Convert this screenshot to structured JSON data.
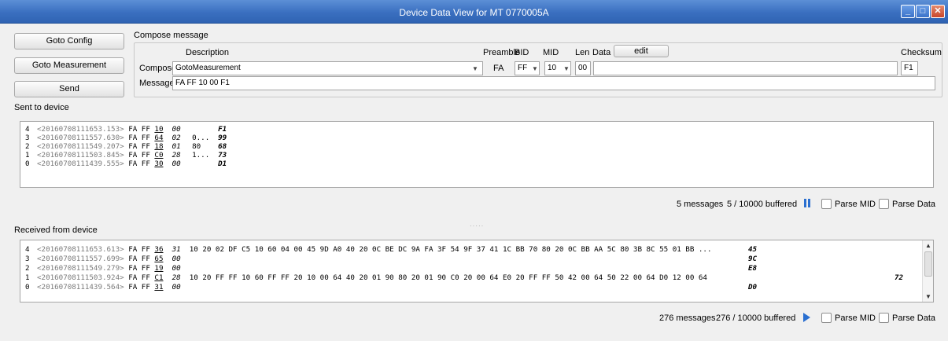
{
  "window": {
    "title": "Device Data View for MT 0770005A"
  },
  "buttons": {
    "goto_config": "Goto Config",
    "goto_measurement": "Goto Measurement",
    "send": "Send",
    "edit": "edit"
  },
  "compose": {
    "group_title": "Compose message",
    "col_description": "Description",
    "col_preamble": "Preamble",
    "col_bid": "BID",
    "col_mid": "MID",
    "col_len": "Len",
    "col_data": "Data",
    "col_checksum": "Checksum",
    "compose_label": "Compose:",
    "description_value": "GotoMeasurement",
    "preamble_value": "FA",
    "bid_value": "FF",
    "mid_value": "10",
    "len_value": "00",
    "data_value": "",
    "checksum_value": "F1",
    "message_label": "Message:",
    "message_value": "FA FF 10 00 F1"
  },
  "sent": {
    "title": "Sent to device",
    "lines": [
      {
        "idx": "4",
        "ts": "<20160708111653.153>",
        "hdr": "FA FF",
        "mid": "10",
        "len": "00",
        "data": "",
        "cs": "F1"
      },
      {
        "idx": "3",
        "ts": "<20160708111557.630>",
        "hdr": "FA FF",
        "mid": "64",
        "len": "02",
        "data": "0...",
        "cs": "99"
      },
      {
        "idx": "2",
        "ts": "<20160708111549.207>",
        "hdr": "FA FF",
        "mid": "18",
        "len": "01",
        "data": "80",
        "cs": "68"
      },
      {
        "idx": "1",
        "ts": "<20160708111503.845>",
        "hdr": "FA FF",
        "mid": "C0",
        "len": "28",
        "data": "1...",
        "cs": "73"
      },
      {
        "idx": "0",
        "ts": "<20160708111439.555>",
        "hdr": "FA FF",
        "mid": "30",
        "len": "00",
        "data": "",
        "cs": "D1"
      }
    ],
    "messages": "5 messages",
    "buffered": "5 / 10000 buffered",
    "pause_icon": "pause-icon",
    "parse_mid": "Parse MID",
    "parse_data": "Parse Data"
  },
  "received": {
    "title": "Received from device",
    "lines": [
      {
        "idx": "4",
        "ts": "<20160708111653.613>",
        "hdr": "FA FF",
        "mid": "36",
        "len": "31",
        "data": "10 20 02 DF C5 10 60 04 00 45 9D A0 40 20 0C BE DC 9A FA 3F 54 9F 37 41 1C BB 70 80 20 0C BB AA 5C 80 3B 8C 55 01 BB ...",
        "cs": "45"
      },
      {
        "idx": "3",
        "ts": "<20160708111557.699>",
        "hdr": "FA FF",
        "mid": "65",
        "len": "00",
        "data": "",
        "cs": "9C"
      },
      {
        "idx": "2",
        "ts": "<20160708111549.279>",
        "hdr": "FA FF",
        "mid": "19",
        "len": "00",
        "data": "",
        "cs": "E8"
      },
      {
        "idx": "1",
        "ts": "<20160708111503.924>",
        "hdr": "FA FF",
        "mid": "C1",
        "len": "28",
        "data": "10 20 FF FF 10 60 FF FF 20 10 00 64 40 20 01 90 80 20 01 90 C0 20 00 64 E0 20 FF FF 50 42 00 64 50 22 00 64 D0 12 00 64",
        "cs": "72"
      },
      {
        "idx": "0",
        "ts": "<20160708111439.564>",
        "hdr": "FA FF",
        "mid": "31",
        "len": "00",
        "data": "",
        "cs": "D0"
      }
    ],
    "messages": "276 messages",
    "buffered": "276 / 10000 buffered",
    "play_icon": "play-icon",
    "parse_mid": "Parse MID",
    "parse_data": "Parse Data"
  },
  "colors": {
    "title_bar": "#3a6fc0",
    "play_blue": "#2a6fd0"
  }
}
